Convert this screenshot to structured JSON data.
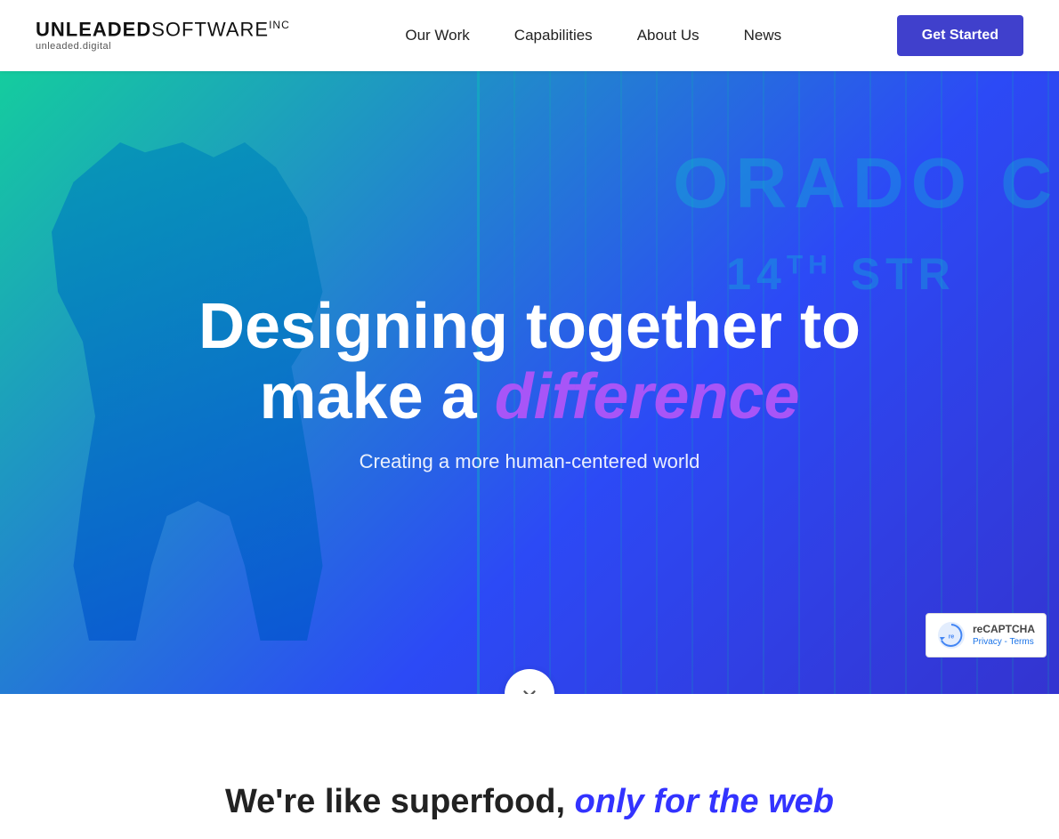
{
  "navbar": {
    "logo": {
      "main": "UNLEADEDSOFTWARE",
      "inc": "inc",
      "sub": "unleaded.digital"
    },
    "links": [
      {
        "id": "our-work",
        "label": "Our Work"
      },
      {
        "id": "capabilities",
        "label": "Capabilities"
      },
      {
        "id": "about-us",
        "label": "About Us"
      },
      {
        "id": "news",
        "label": "News"
      }
    ],
    "cta_label": "Get Started"
  },
  "hero": {
    "title_line1": "Designing together to",
    "title_line2": "make a ",
    "title_highlight": "difference",
    "subtitle": "Creating a more human-centered world",
    "street_text": "ORADO C",
    "street_num": "14TH STR"
  },
  "below_hero": {
    "text_start": "We're like superfood,",
    "text_colored": "only for the web"
  },
  "recaptcha": {
    "title": "reCAPTCHA",
    "links": "Privacy - Terms"
  }
}
